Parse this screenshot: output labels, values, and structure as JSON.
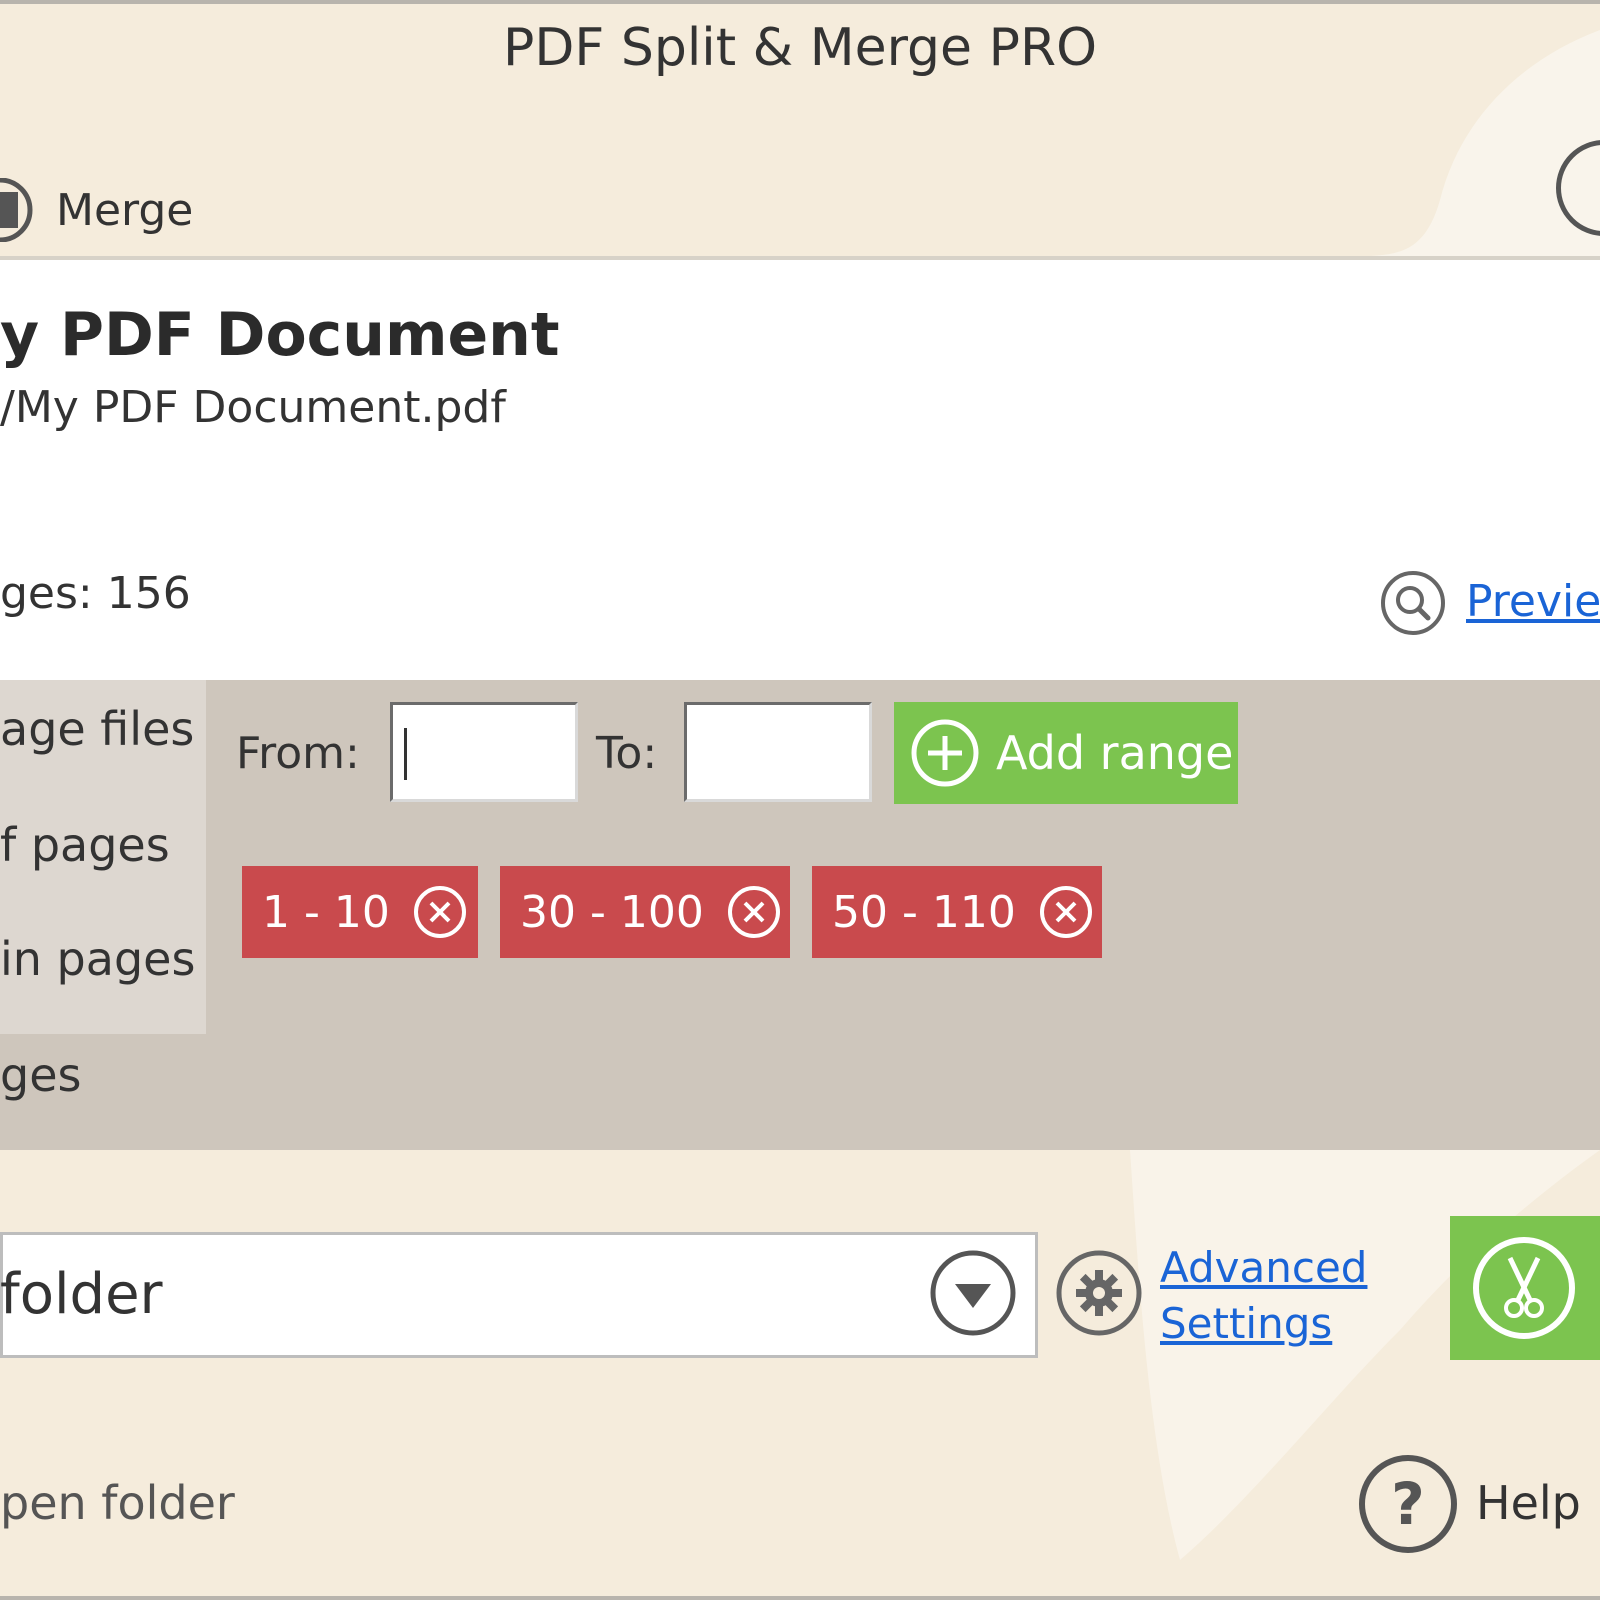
{
  "window": {
    "title": "PDF Split & Merge PRO"
  },
  "toolbar": {
    "merge_label": "Merge"
  },
  "document": {
    "title": "y PDF Document",
    "path": "/My PDF Document.pdf",
    "pages_label": "ges: 156",
    "preview_label": "Previe"
  },
  "modes": [
    {
      "label": "age files"
    },
    {
      "label": "f pages"
    },
    {
      "label": "in pages"
    },
    {
      "label": "ges"
    }
  ],
  "range": {
    "from_label": "From:",
    "to_label": "To:",
    "from_value": "",
    "to_value": "",
    "add_label": "Add range",
    "tags": [
      "1 - 10",
      "30 - 100",
      "50 - 110"
    ]
  },
  "output": {
    "folder_text": "folder",
    "advanced_line1": "Advanced",
    "advanced_line2": "Settings"
  },
  "footer": {
    "open_folder_label": "pen folder",
    "help_label": "Help"
  },
  "colors": {
    "background": "#f5ecdc",
    "accent_green": "#7cc44f",
    "tag_red": "#c94a4d",
    "link_blue": "#1a64d6",
    "panel_gray": "#cec6bc"
  },
  "icons": {
    "merge": "merge-icon",
    "preview": "magnifier-icon",
    "add": "plus-circle-icon",
    "remove": "close-circle-icon",
    "dropdown": "chevron-down-icon",
    "settings": "gear-icon",
    "split": "scissors-icon",
    "help": "question-icon"
  }
}
